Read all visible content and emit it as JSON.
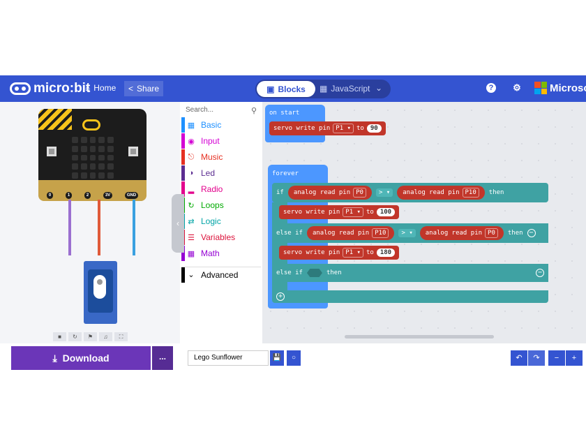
{
  "header": {
    "logo_text": "micro:bit",
    "home_label": "Home",
    "share_label": "Share",
    "blocks_label": "Blocks",
    "javascript_label": "JavaScript",
    "help_icon": "?",
    "brand": "Microsoft"
  },
  "simulator": {
    "pins": [
      "0",
      "1",
      "2",
      "3V",
      "GND"
    ],
    "controls": [
      "stop-icon",
      "restart-icon",
      "slowmo-icon",
      "sound-icon",
      "fullscreen-icon"
    ]
  },
  "toolbox": {
    "search_placeholder": "Search...",
    "categories": [
      {
        "label": "Basic",
        "color": "#1e90ff"
      },
      {
        "label": "Input",
        "color": "#d400d4"
      },
      {
        "label": "Music",
        "color": "#e63022"
      },
      {
        "label": "Led",
        "color": "#5c2d91"
      },
      {
        "label": "Radio",
        "color": "#e3008c"
      },
      {
        "label": "Loops",
        "color": "#00aa00"
      },
      {
        "label": "Logic",
        "color": "#00a4a6"
      },
      {
        "label": "Variables",
        "color": "#dc143c"
      },
      {
        "label": "Math",
        "color": "#9400d3"
      },
      {
        "label": "Advanced",
        "color": "#000000"
      }
    ]
  },
  "workspace": {
    "on_start": {
      "label": "on start",
      "servo": {
        "text": "servo write pin",
        "pin": "P1",
        "to": "to",
        "value": "90"
      }
    },
    "forever": {
      "label": "forever",
      "if_label": "if",
      "then_label": "then",
      "else_if_label": "else if",
      "analog_read": "analog read pin",
      "cond1": {
        "left_pin": "P0",
        "op": ">",
        "right_pin": "P10"
      },
      "servo1": {
        "text": "servo write pin",
        "pin": "P1",
        "to": "to",
        "value": "100"
      },
      "cond2": {
        "left_pin": "P10",
        "op": ">",
        "right_pin": "P0"
      },
      "servo2": {
        "text": "servo write pin",
        "pin": "P1",
        "to": "to",
        "value": "180"
      }
    }
  },
  "footer": {
    "download_label": "Download",
    "more_label": "...",
    "project_name": "Lego Sunflower"
  }
}
